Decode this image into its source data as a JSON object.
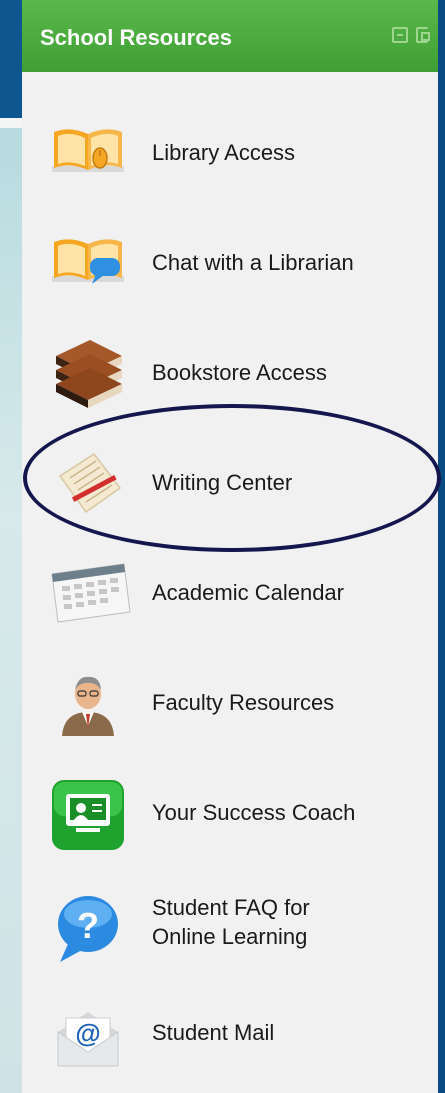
{
  "panel": {
    "title": "School Resources"
  },
  "items": [
    {
      "label": "Library Access",
      "icon": "book-mouse-icon"
    },
    {
      "label": "Chat with a Librarian",
      "icon": "book-chat-icon"
    },
    {
      "label": "Bookstore Access",
      "icon": "books-stack-icon"
    },
    {
      "label": "Writing Center",
      "icon": "writing-paper-icon"
    },
    {
      "label": "Academic Calendar",
      "icon": "calendar-icon"
    },
    {
      "label": "Faculty Resources",
      "icon": "faculty-person-icon"
    },
    {
      "label": "Your Success Coach",
      "icon": "coach-screen-icon"
    },
    {
      "label": "Student FAQ for",
      "label2": "Online Learning",
      "icon": "question-bubble-icon"
    },
    {
      "label": "Student Mail",
      "icon": "mail-at-icon"
    }
  ],
  "colors": {
    "header_green": "#3f9f34",
    "page_blue": "#0e5690",
    "highlight_ring": "#14164e"
  }
}
